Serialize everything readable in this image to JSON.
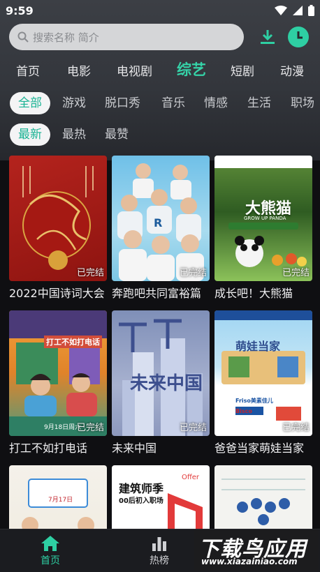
{
  "status": {
    "time": "9:59"
  },
  "search": {
    "placeholder": "搜索名称 简介"
  },
  "main_tabs": [
    "首页",
    "电影",
    "电视剧",
    "综艺",
    "短剧",
    "动漫"
  ],
  "categories": [
    "全部",
    "游戏",
    "脱口秀",
    "音乐",
    "情感",
    "生活",
    "职场"
  ],
  "sort": [
    "最新",
    "最热",
    "最赞"
  ],
  "poster_text": {
    "p3_main": "大熊猫",
    "p3_sub": "GROW UP PANDA",
    "p4_main": "打工不如打电话",
    "p4_date": "9月18日周六",
    "p5_main": "未来中国",
    "p6_main": "萌娃当家",
    "p6_brand": "Friso美素佳儿",
    "p6_brand2": "Bisco",
    "p7_date": "7月17日",
    "p8_main": "建筑师季",
    "p8_sub": "00后初入职场",
    "p8_tag": "Offer"
  },
  "cards": [
    {
      "title": "2022中国诗词大会",
      "badge": "已完结"
    },
    {
      "title": "奔跑吧共同富裕篇",
      "badge": "已完结"
    },
    {
      "title": "成长吧！大熊猫",
      "badge": "已完结"
    },
    {
      "title": "打工不如打电话",
      "badge": "已完结"
    },
    {
      "title": "未来中国",
      "badge": "已完结"
    },
    {
      "title": "爸爸当家萌娃当家",
      "badge": "已完结"
    },
    {
      "title": "",
      "badge": ""
    },
    {
      "title": "",
      "badge": ""
    },
    {
      "title": "",
      "badge": ""
    }
  ],
  "bottom_nav": [
    "首页",
    "热榜"
  ],
  "watermark": {
    "main": "下载鸟应用",
    "sub": "www.xiazainiao.com"
  },
  "colors": {
    "accent": "#2ecfa3",
    "background": "#0f0f12"
  }
}
